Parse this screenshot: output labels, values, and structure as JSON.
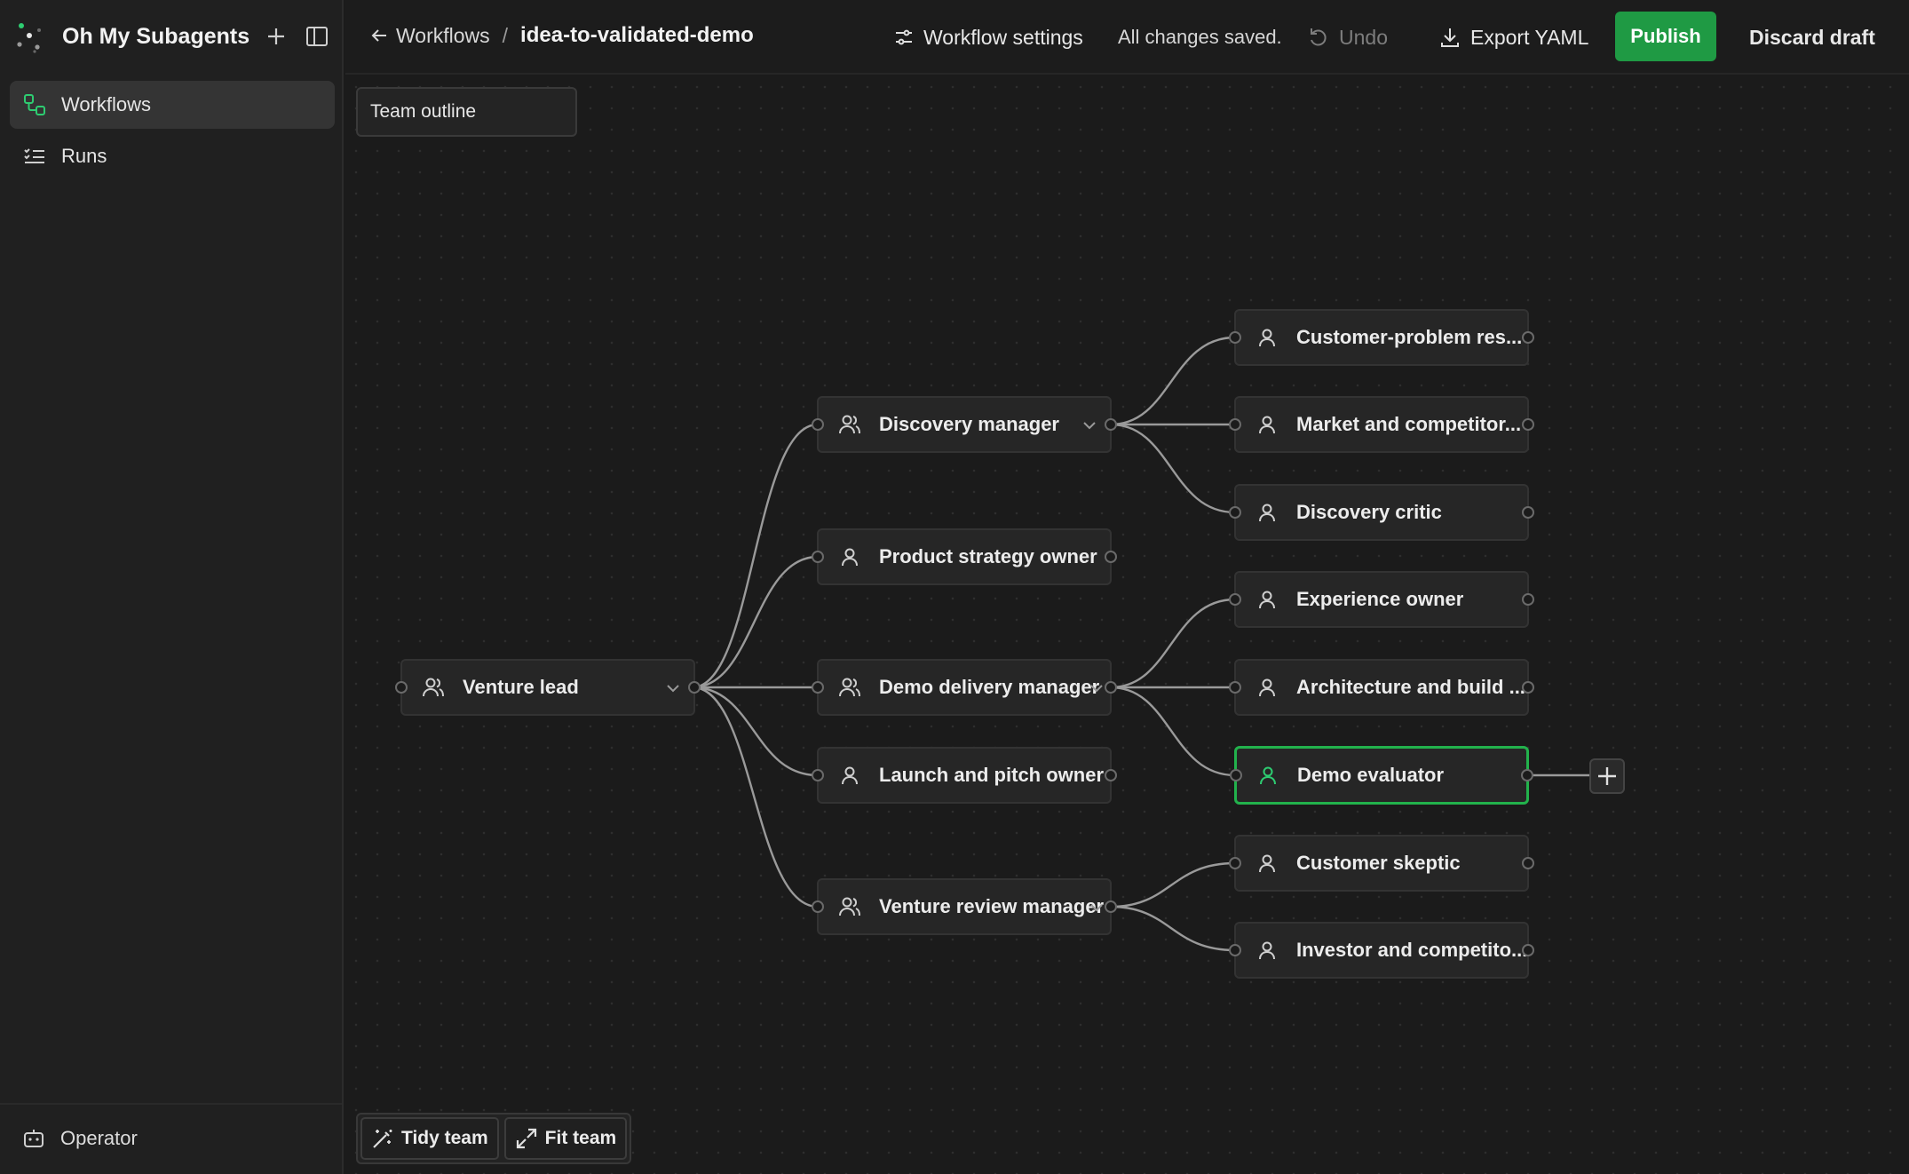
{
  "app": {
    "name": "Oh My Subagents"
  },
  "sidebar": {
    "items": [
      {
        "label": "Workflows",
        "icon": "workflow-icon",
        "active": true
      },
      {
        "label": "Runs",
        "icon": "list-icon",
        "active": false
      }
    ],
    "footer": {
      "label": "Operator",
      "icon": "bot-icon"
    }
  },
  "header": {
    "breadcrumb_parent": "Workflows",
    "breadcrumb_separator": "/",
    "breadcrumb_current": "idea-to-validated-demo",
    "settings_label": "Workflow settings",
    "status": "All changes saved.",
    "undo_label": "Undo",
    "export_label": "Export YAML",
    "publish_label": "Publish",
    "discard_label": "Discard draft"
  },
  "canvas": {
    "outline_button": "Team outline",
    "nodes": {
      "venture_lead": {
        "label": "Venture lead",
        "type": "manager"
      },
      "discovery_manager": {
        "label": "Discovery manager",
        "type": "manager"
      },
      "product_strategy_owner": {
        "label": "Product strategy owner",
        "type": "agent"
      },
      "demo_delivery_manager": {
        "label": "Demo delivery manager",
        "type": "manager"
      },
      "launch_and_pitch_owner": {
        "label": "Launch and pitch owner",
        "type": "agent"
      },
      "venture_review_manager": {
        "label": "Venture review manager",
        "type": "manager"
      },
      "customer_problem_res": {
        "label": "Customer-problem res...",
        "type": "agent"
      },
      "market_and_competitor": {
        "label": "Market and competitor...",
        "type": "agent"
      },
      "discovery_critic": {
        "label": "Discovery critic",
        "type": "agent"
      },
      "experience_owner": {
        "label": "Experience owner",
        "type": "agent"
      },
      "architecture_and_build": {
        "label": "Architecture and build ...",
        "type": "agent"
      },
      "demo_evaluator": {
        "label": "Demo evaluator",
        "type": "agent",
        "selected": true
      },
      "customer_skeptic": {
        "label": "Customer skeptic",
        "type": "agent"
      },
      "investor_and_competito": {
        "label": "Investor and competito...",
        "type": "agent"
      }
    },
    "toolbar": {
      "tidy_label": "Tidy team",
      "fit_label": "Fit team"
    }
  },
  "colors": {
    "accent": "#1f9a44",
    "selected_border": "#22b24c",
    "background": "#1b1b1b"
  }
}
